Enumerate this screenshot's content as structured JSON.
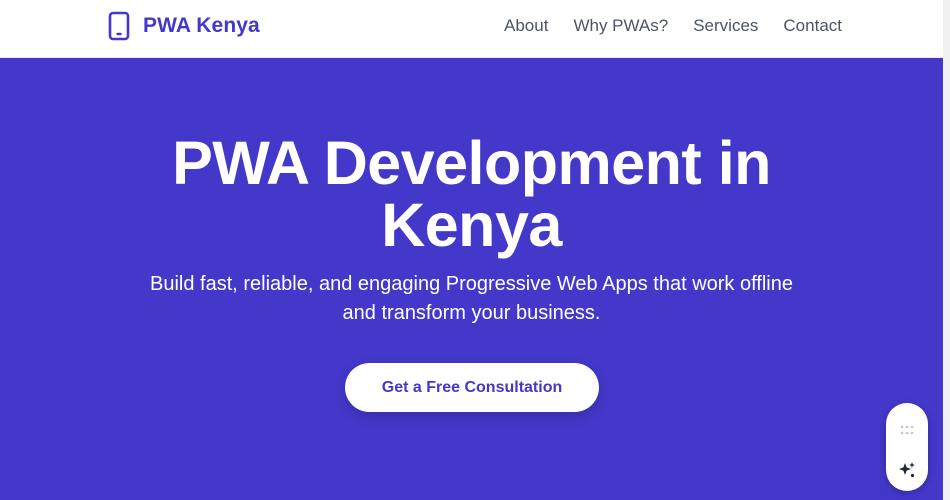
{
  "header": {
    "brand": "PWA Kenya",
    "brand_icon": "smartphone-icon",
    "nav": [
      "About",
      "Why PWAs?",
      "Services",
      "Contact"
    ]
  },
  "hero": {
    "title_line1": "PWA Development in",
    "title_line2": "Kenya",
    "subtitle_line1": "Build fast, reliable, and engaging Progressive Web Apps that work offline",
    "subtitle_line2": "and transform your business.",
    "cta": "Get a Free Consultation"
  },
  "widget": {
    "icons": [
      "drag-handle-icon",
      "sparkle-icon"
    ]
  },
  "colors": {
    "primary": "#4338ca",
    "nav_text": "#4b5563",
    "hero_text": "#ffffff"
  }
}
